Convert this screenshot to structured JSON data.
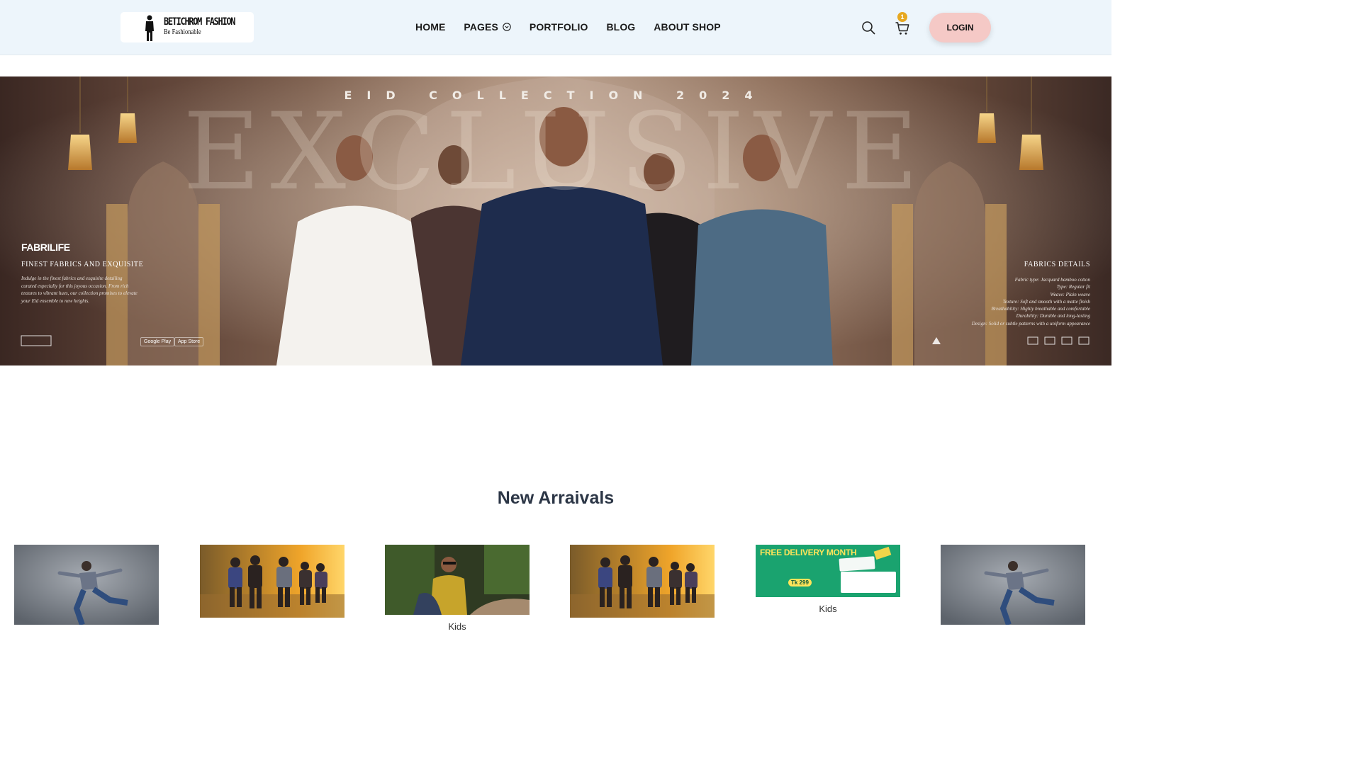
{
  "header": {
    "logo": {
      "name": "BETICHROM FASHION",
      "tagline": "Be Fashionable"
    },
    "nav": [
      {
        "label": "HOME"
      },
      {
        "label": "PAGES",
        "has_dropdown": true
      },
      {
        "label": "PORTFOLIO"
      },
      {
        "label": "BLOG"
      },
      {
        "label": "ABOUT SHOP"
      }
    ],
    "cart_count": "1",
    "login_label": "LOGIN",
    "icons": [
      "search-icon",
      "cart-icon",
      "chevron-down-icon"
    ]
  },
  "banner": {
    "headline": "EID COLLECTION 2024",
    "big_word": "EXCLUSIVE",
    "brand": "FABRILIFE",
    "left_title": "FINEST FABRICS AND EXQUISITE",
    "left_body": "Indulge in the finest fabrics and exquisite detailing curated especially for this joyous occasion. From rich textures to vibrant hues, our collection promises to elevate your Eid ensemble to new heights.",
    "right_title": "FABRICS DETAILS",
    "right_body": [
      "Fabric type: Jacquard bamboo cotton",
      "Type: Regular fit",
      "Weave: Plain weave",
      "Texture: Soft and smooth with a matte finish",
      "Breathability: Highly breathable and comfortable",
      "Durability: Durable and long-lasting",
      "Design: Solid or subtle patterns with a uniform appearance"
    ],
    "store_google": "Google Play",
    "store_apple": "App Store",
    "colors": {
      "bg_dark": "#3a2722",
      "bg_mid": "#a88a76",
      "gold": "#e0b35a"
    }
  },
  "arrivals": {
    "title": "New Arraivals",
    "cards": [
      {
        "image": "man-jumping-grey"
      },
      {
        "image": "group-running-sunset"
      },
      {
        "image": "man-yellow-tshirt",
        "label": "Kids"
      },
      {
        "image": "group-running-sunset"
      },
      {
        "image": "free-delivery-promo",
        "label": "Kids",
        "promo_title": "FREE DELIVERY MONTH",
        "promo_price": "Tk 299"
      },
      {
        "image": "man-jumping-grey"
      }
    ]
  },
  "colors": {
    "header_bg": "#edf5fb",
    "login_bg": "#f5c9c6",
    "badge": "#e7a820",
    "promo_green": "#1aa36f"
  }
}
